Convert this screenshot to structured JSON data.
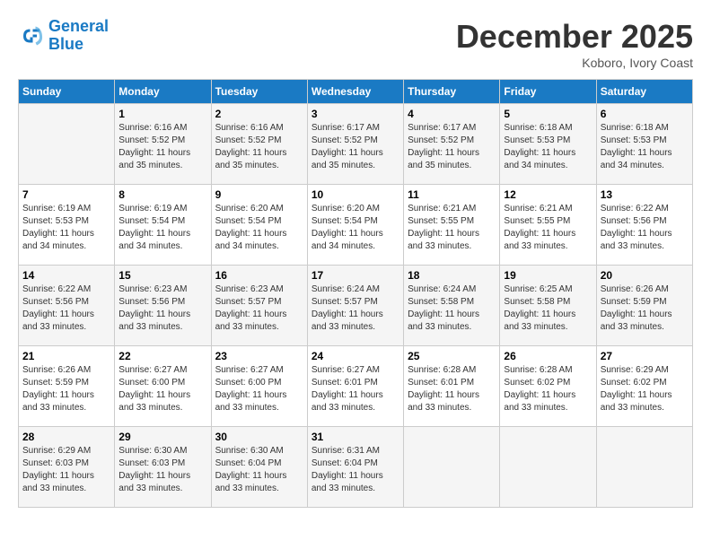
{
  "header": {
    "logo_line1": "General",
    "logo_line2": "Blue",
    "month_title": "December 2025",
    "location": "Koboro, Ivory Coast"
  },
  "weekdays": [
    "Sunday",
    "Monday",
    "Tuesday",
    "Wednesday",
    "Thursday",
    "Friday",
    "Saturday"
  ],
  "weeks": [
    [
      {
        "day": "",
        "sunrise": "",
        "sunset": "",
        "daylight": ""
      },
      {
        "day": "1",
        "sunrise": "Sunrise: 6:16 AM",
        "sunset": "Sunset: 5:52 PM",
        "daylight": "Daylight: 11 hours and 35 minutes."
      },
      {
        "day": "2",
        "sunrise": "Sunrise: 6:16 AM",
        "sunset": "Sunset: 5:52 PM",
        "daylight": "Daylight: 11 hours and 35 minutes."
      },
      {
        "day": "3",
        "sunrise": "Sunrise: 6:17 AM",
        "sunset": "Sunset: 5:52 PM",
        "daylight": "Daylight: 11 hours and 35 minutes."
      },
      {
        "day": "4",
        "sunrise": "Sunrise: 6:17 AM",
        "sunset": "Sunset: 5:52 PM",
        "daylight": "Daylight: 11 hours and 35 minutes."
      },
      {
        "day": "5",
        "sunrise": "Sunrise: 6:18 AM",
        "sunset": "Sunset: 5:53 PM",
        "daylight": "Daylight: 11 hours and 34 minutes."
      },
      {
        "day": "6",
        "sunrise": "Sunrise: 6:18 AM",
        "sunset": "Sunset: 5:53 PM",
        "daylight": "Daylight: 11 hours and 34 minutes."
      }
    ],
    [
      {
        "day": "7",
        "sunrise": "Sunrise: 6:19 AM",
        "sunset": "Sunset: 5:53 PM",
        "daylight": "Daylight: 11 hours and 34 minutes."
      },
      {
        "day": "8",
        "sunrise": "Sunrise: 6:19 AM",
        "sunset": "Sunset: 5:54 PM",
        "daylight": "Daylight: 11 hours and 34 minutes."
      },
      {
        "day": "9",
        "sunrise": "Sunrise: 6:20 AM",
        "sunset": "Sunset: 5:54 PM",
        "daylight": "Daylight: 11 hours and 34 minutes."
      },
      {
        "day": "10",
        "sunrise": "Sunrise: 6:20 AM",
        "sunset": "Sunset: 5:54 PM",
        "daylight": "Daylight: 11 hours and 34 minutes."
      },
      {
        "day": "11",
        "sunrise": "Sunrise: 6:21 AM",
        "sunset": "Sunset: 5:55 PM",
        "daylight": "Daylight: 11 hours and 33 minutes."
      },
      {
        "day": "12",
        "sunrise": "Sunrise: 6:21 AM",
        "sunset": "Sunset: 5:55 PM",
        "daylight": "Daylight: 11 hours and 33 minutes."
      },
      {
        "day": "13",
        "sunrise": "Sunrise: 6:22 AM",
        "sunset": "Sunset: 5:56 PM",
        "daylight": "Daylight: 11 hours and 33 minutes."
      }
    ],
    [
      {
        "day": "14",
        "sunrise": "Sunrise: 6:22 AM",
        "sunset": "Sunset: 5:56 PM",
        "daylight": "Daylight: 11 hours and 33 minutes."
      },
      {
        "day": "15",
        "sunrise": "Sunrise: 6:23 AM",
        "sunset": "Sunset: 5:56 PM",
        "daylight": "Daylight: 11 hours and 33 minutes."
      },
      {
        "day": "16",
        "sunrise": "Sunrise: 6:23 AM",
        "sunset": "Sunset: 5:57 PM",
        "daylight": "Daylight: 11 hours and 33 minutes."
      },
      {
        "day": "17",
        "sunrise": "Sunrise: 6:24 AM",
        "sunset": "Sunset: 5:57 PM",
        "daylight": "Daylight: 11 hours and 33 minutes."
      },
      {
        "day": "18",
        "sunrise": "Sunrise: 6:24 AM",
        "sunset": "Sunset: 5:58 PM",
        "daylight": "Daylight: 11 hours and 33 minutes."
      },
      {
        "day": "19",
        "sunrise": "Sunrise: 6:25 AM",
        "sunset": "Sunset: 5:58 PM",
        "daylight": "Daylight: 11 hours and 33 minutes."
      },
      {
        "day": "20",
        "sunrise": "Sunrise: 6:26 AM",
        "sunset": "Sunset: 5:59 PM",
        "daylight": "Daylight: 11 hours and 33 minutes."
      }
    ],
    [
      {
        "day": "21",
        "sunrise": "Sunrise: 6:26 AM",
        "sunset": "Sunset: 5:59 PM",
        "daylight": "Daylight: 11 hours and 33 minutes."
      },
      {
        "day": "22",
        "sunrise": "Sunrise: 6:27 AM",
        "sunset": "Sunset: 6:00 PM",
        "daylight": "Daylight: 11 hours and 33 minutes."
      },
      {
        "day": "23",
        "sunrise": "Sunrise: 6:27 AM",
        "sunset": "Sunset: 6:00 PM",
        "daylight": "Daylight: 11 hours and 33 minutes."
      },
      {
        "day": "24",
        "sunrise": "Sunrise: 6:27 AM",
        "sunset": "Sunset: 6:01 PM",
        "daylight": "Daylight: 11 hours and 33 minutes."
      },
      {
        "day": "25",
        "sunrise": "Sunrise: 6:28 AM",
        "sunset": "Sunset: 6:01 PM",
        "daylight": "Daylight: 11 hours and 33 minutes."
      },
      {
        "day": "26",
        "sunrise": "Sunrise: 6:28 AM",
        "sunset": "Sunset: 6:02 PM",
        "daylight": "Daylight: 11 hours and 33 minutes."
      },
      {
        "day": "27",
        "sunrise": "Sunrise: 6:29 AM",
        "sunset": "Sunset: 6:02 PM",
        "daylight": "Daylight: 11 hours and 33 minutes."
      }
    ],
    [
      {
        "day": "28",
        "sunrise": "Sunrise: 6:29 AM",
        "sunset": "Sunset: 6:03 PM",
        "daylight": "Daylight: 11 hours and 33 minutes."
      },
      {
        "day": "29",
        "sunrise": "Sunrise: 6:30 AM",
        "sunset": "Sunset: 6:03 PM",
        "daylight": "Daylight: 11 hours and 33 minutes."
      },
      {
        "day": "30",
        "sunrise": "Sunrise: 6:30 AM",
        "sunset": "Sunset: 6:04 PM",
        "daylight": "Daylight: 11 hours and 33 minutes."
      },
      {
        "day": "31",
        "sunrise": "Sunrise: 6:31 AM",
        "sunset": "Sunset: 6:04 PM",
        "daylight": "Daylight: 11 hours and 33 minutes."
      },
      {
        "day": "",
        "sunrise": "",
        "sunset": "",
        "daylight": ""
      },
      {
        "day": "",
        "sunrise": "",
        "sunset": "",
        "daylight": ""
      },
      {
        "day": "",
        "sunrise": "",
        "sunset": "",
        "daylight": ""
      }
    ]
  ]
}
